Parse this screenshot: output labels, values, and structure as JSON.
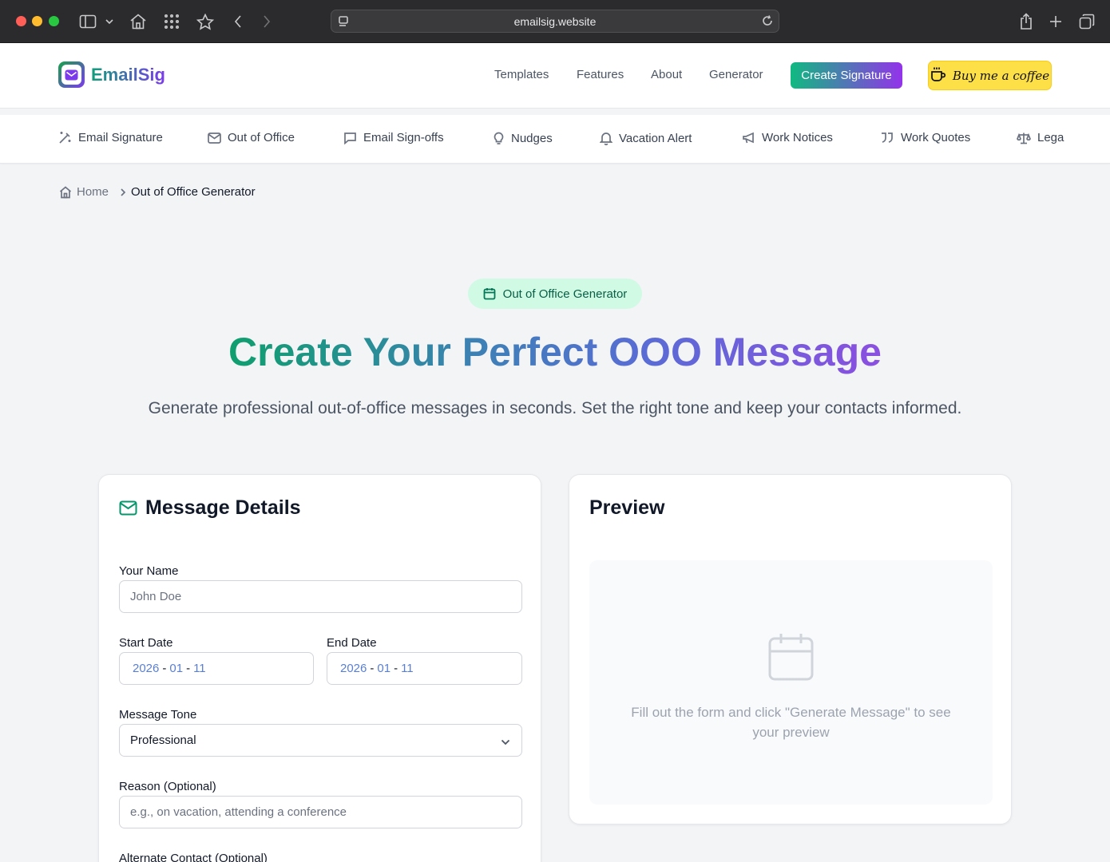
{
  "browser": {
    "url": "emailsig.website"
  },
  "header": {
    "brand": "EmailSig",
    "nav": [
      "Templates",
      "Features",
      "About",
      "Generator"
    ],
    "cta_label": "Create Signature",
    "coffee_label": "Buy me a coffee"
  },
  "tools": [
    {
      "label": "Email Signature",
      "icon": "magic-wand-icon"
    },
    {
      "label": "Out of Office",
      "icon": "mail-icon"
    },
    {
      "label": "Email Sign-offs",
      "icon": "message-icon"
    },
    {
      "label": "Nudges",
      "icon": "lightbulb-icon"
    },
    {
      "label": "Vacation Alert",
      "icon": "bell-icon"
    },
    {
      "label": "Work Notices",
      "icon": "megaphone-icon"
    },
    {
      "label": "Work Quotes",
      "icon": "quote-icon"
    },
    {
      "label": "Lega",
      "icon": "scale-icon"
    }
  ],
  "breadcrumb": {
    "home": "Home",
    "current": "Out of Office Generator"
  },
  "hero": {
    "pill": "Out of Office Generator",
    "title": "Create Your Perfect OOO Message",
    "subtitle": "Generate professional out-of-office messages in seconds. Set the right tone and keep your contacts informed."
  },
  "form": {
    "title": "Message Details",
    "name_label": "Your Name",
    "name_placeholder": "John Doe",
    "start_label": "Start Date",
    "end_label": "End Date",
    "start_date": {
      "year": "2026",
      "month": "01",
      "day": "11"
    },
    "end_date": {
      "year": "2026",
      "month": "01",
      "day": "11"
    },
    "date_sep": "-",
    "tone_label": "Message Tone",
    "tone_value": "Professional",
    "reason_label": "Reason (Optional)",
    "reason_placeholder": "e.g., on vacation, attending a conference",
    "alternate_label": "Alternate Contact (Optional)"
  },
  "preview": {
    "title": "Preview",
    "empty_message": "Fill out the form and click \"Generate Message\" to see your preview"
  },
  "colors": {
    "brand_green": "#10b981",
    "brand_purple": "#9333ea",
    "coffee_yellow": "#fde047"
  }
}
